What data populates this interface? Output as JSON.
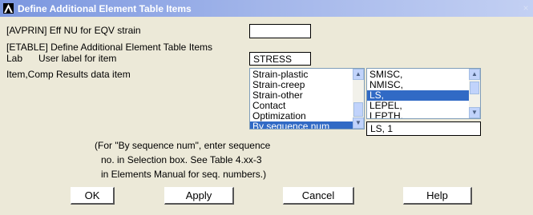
{
  "title": "Define Additional Element Table Items",
  "avprin": {
    "label": "[AVPRIN]  Eff NU for EQV strain",
    "value": ""
  },
  "etable_label": "[ETABLE]  Define Additional Element Table Items",
  "lab": {
    "label": "Lab      User label for item",
    "value": "STRESS"
  },
  "item_comp": {
    "label": "Item,Comp  Results data item",
    "left_list": {
      "items": [
        "Strain-plastic",
        "Strain-creep",
        "Strain-other",
        "Contact",
        "Optimization",
        "By sequence num"
      ],
      "selected": "By sequence num"
    },
    "right_list": {
      "items": [
        "SMISC,",
        "NMISC,",
        "LS,",
        "LEPEL,",
        "LEPTH,"
      ],
      "selected": "LS,"
    },
    "value": "LS, 1"
  },
  "note_lines": [
    "(For \"By sequence num\", enter sequence",
    "no. in Selection box.  See Table 4.xx-3",
    "in Elements Manual for seq. numbers.)"
  ],
  "buttons": {
    "ok": "OK",
    "apply": "Apply",
    "cancel": "Cancel",
    "help": "Help"
  },
  "close_icon": "×",
  "icons": {
    "logo": "ansys-logo-icon",
    "close": "close-icon"
  },
  "colors": {
    "title_bar": "#7a96df",
    "selection": "#316ac5",
    "dialog_bg": "#ece9d8"
  }
}
